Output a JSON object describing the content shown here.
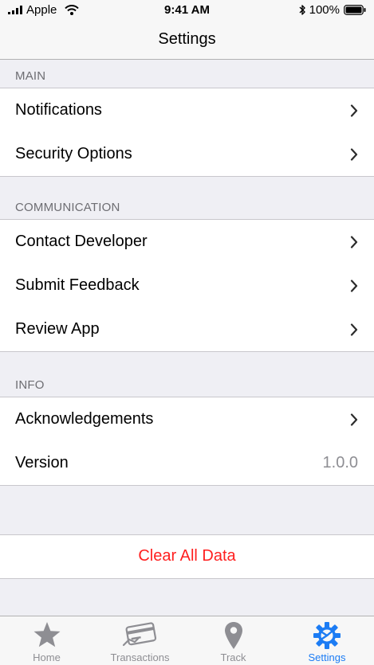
{
  "status_bar": {
    "carrier": "Apple",
    "time": "9:41 AM",
    "battery": "100%"
  },
  "nav": {
    "title": "Settings"
  },
  "sections": {
    "main": {
      "header": "MAIN",
      "items": [
        {
          "label": "Notifications"
        },
        {
          "label": "Security Options"
        }
      ]
    },
    "communication": {
      "header": "COMMUNICATION",
      "items": [
        {
          "label": "Contact Developer"
        },
        {
          "label": "Submit Feedback"
        },
        {
          "label": "Review App"
        }
      ]
    },
    "info": {
      "header": "INFO",
      "items": [
        {
          "label": "Acknowledgements"
        },
        {
          "label": "Version",
          "value": "1.0.0"
        }
      ]
    }
  },
  "clear_data": {
    "label": "Clear All Data",
    "color": "#ff1f1f"
  },
  "tab_bar": {
    "active_color": "#1c7cf4",
    "inactive_color": "#8e8e93",
    "tabs": [
      {
        "label": "Home",
        "icon": "star-icon",
        "active": false
      },
      {
        "label": "Transactions",
        "icon": "card-icon",
        "active": false
      },
      {
        "label": "Track",
        "icon": "location-pin-icon",
        "active": false
      },
      {
        "label": "Settings",
        "icon": "gear-icon",
        "active": true
      }
    ]
  }
}
